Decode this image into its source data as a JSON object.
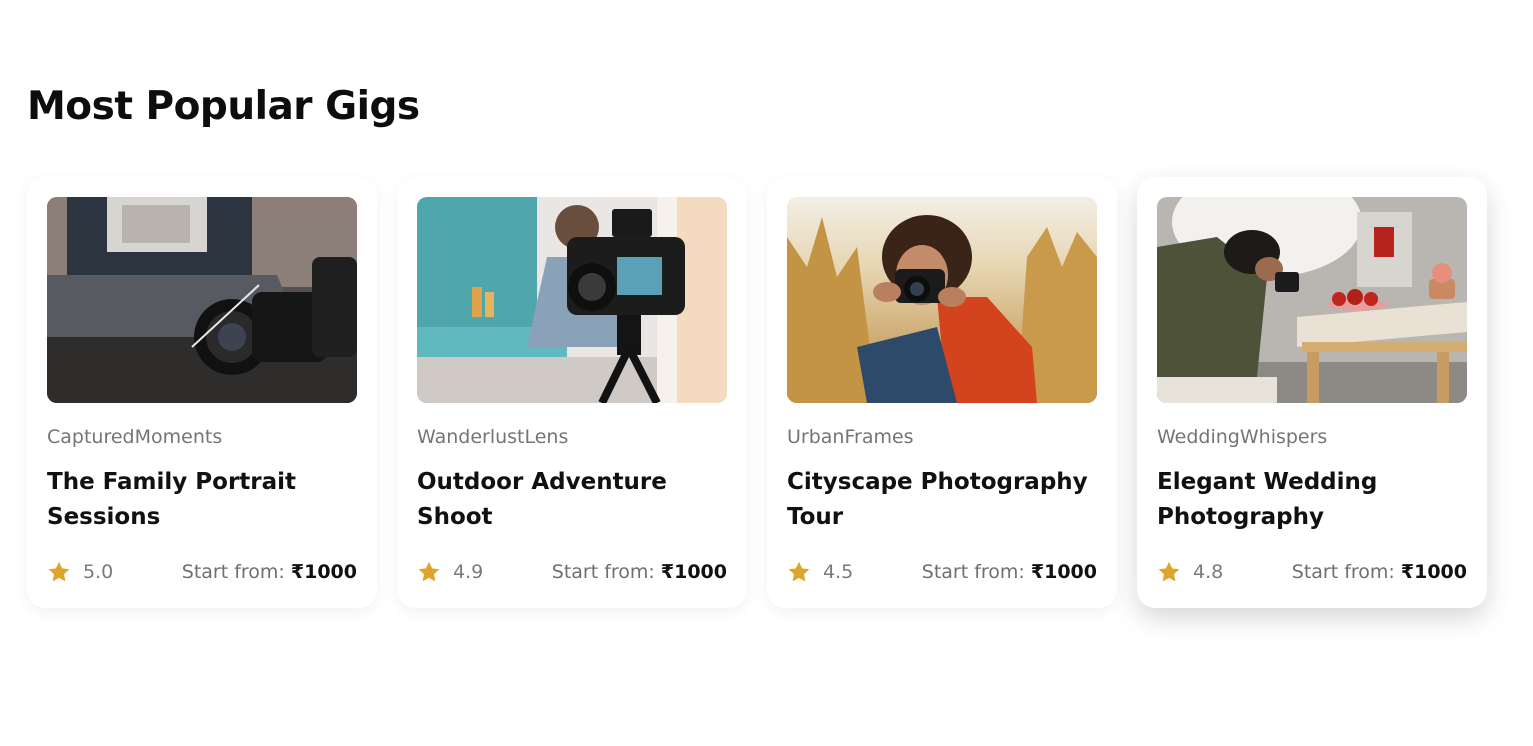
{
  "section": {
    "title": "Most Popular Gigs"
  },
  "colors": {
    "star": "#DDA52B",
    "text_dark": "#111111",
    "text_muted": "#757575"
  },
  "gigs": [
    {
      "seller": "CapturedMoments",
      "title": "The Family Portrait Sessions",
      "rating": "5.0",
      "price_label": "Start from:",
      "price": "₹1000",
      "image": "camera-lens-on-laptop-photo"
    },
    {
      "seller": "WanderlustLens",
      "title": "Outdoor Adventure Shoot",
      "rating": "4.9",
      "price_label": "Start from:",
      "price": "₹1000",
      "image": "camera-on-tripod-studio-photo"
    },
    {
      "seller": "UrbanFrames",
      "title": "Cityscape Photography Tour",
      "rating": "4.5",
      "price_label": "Start from:",
      "price": "₹1000",
      "image": "photographer-in-wheat-field-photo"
    },
    {
      "seller": "WeddingWhispers",
      "title": "Elegant Wedding Photography",
      "rating": "4.8",
      "price_label": "Start from:",
      "price": "₹1000",
      "image": "photographer-shooting-table-setup-photo"
    }
  ]
}
